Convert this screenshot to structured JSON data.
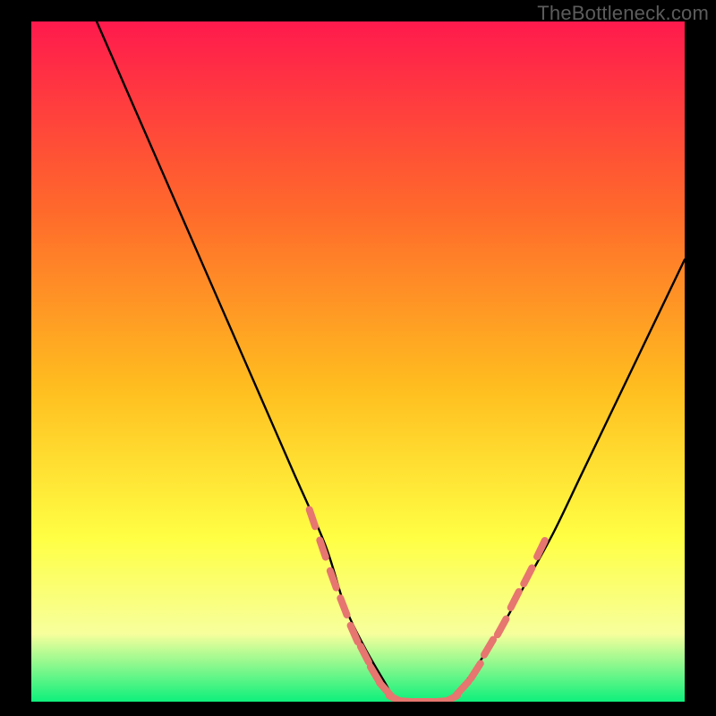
{
  "watermark": "TheBottleneck.com",
  "colors": {
    "background": "#000000",
    "gradient_top": "#ff1a4d",
    "gradient_mid1": "#ff6a2b",
    "gradient_mid2": "#ffbe1f",
    "gradient_mid3": "#ffff44",
    "gradient_mid4": "#f7ff9c",
    "gradient_bottom": "#0ef07c",
    "curve": "#000000",
    "markers": "#e6766f"
  },
  "chart_data": {
    "type": "line",
    "title": "",
    "xlabel": "",
    "ylabel": "",
    "xlim": [
      0,
      100
    ],
    "ylim": [
      0,
      100
    ],
    "series": [
      {
        "name": "left-branch",
        "x": [
          10,
          15,
          20,
          25,
          30,
          35,
          40,
          45,
          48,
          51,
          54,
          56
        ],
        "values": [
          100,
          89,
          78,
          67,
          56,
          45,
          34,
          23,
          14,
          8,
          3,
          0
        ]
      },
      {
        "name": "right-branch",
        "x": [
          64,
          68,
          72,
          76,
          80,
          84,
          88,
          92,
          96,
          100
        ],
        "values": [
          0,
          5,
          11,
          18,
          25,
          33,
          41,
          49,
          57,
          65
        ]
      },
      {
        "name": "valley-floor",
        "x": [
          56,
          58,
          60,
          62,
          64
        ],
        "values": [
          0,
          0,
          0,
          0,
          0
        ]
      }
    ],
    "markers": {
      "name": "dashed-segments",
      "points": [
        {
          "x": 43.0,
          "y": 27.0
        },
        {
          "x": 44.6,
          "y": 22.5
        },
        {
          "x": 46.2,
          "y": 18.0
        },
        {
          "x": 47.8,
          "y": 14.0
        },
        {
          "x": 49.4,
          "y": 10.0
        },
        {
          "x": 51.0,
          "y": 7.0
        },
        {
          "x": 52.6,
          "y": 4.0
        },
        {
          "x": 54.2,
          "y": 1.8
        },
        {
          "x": 56.0,
          "y": 0.3
        },
        {
          "x": 58.0,
          "y": 0.0
        },
        {
          "x": 60.0,
          "y": 0.0
        },
        {
          "x": 62.0,
          "y": 0.0
        },
        {
          "x": 64.0,
          "y": 0.3
        },
        {
          "x": 66.0,
          "y": 2.0
        },
        {
          "x": 68.0,
          "y": 4.5
        },
        {
          "x": 70.0,
          "y": 8.0
        },
        {
          "x": 72.0,
          "y": 11.0
        },
        {
          "x": 74.0,
          "y": 15.0
        },
        {
          "x": 76.0,
          "y": 18.5
        },
        {
          "x": 78.0,
          "y": 22.5
        }
      ]
    },
    "annotations": []
  }
}
